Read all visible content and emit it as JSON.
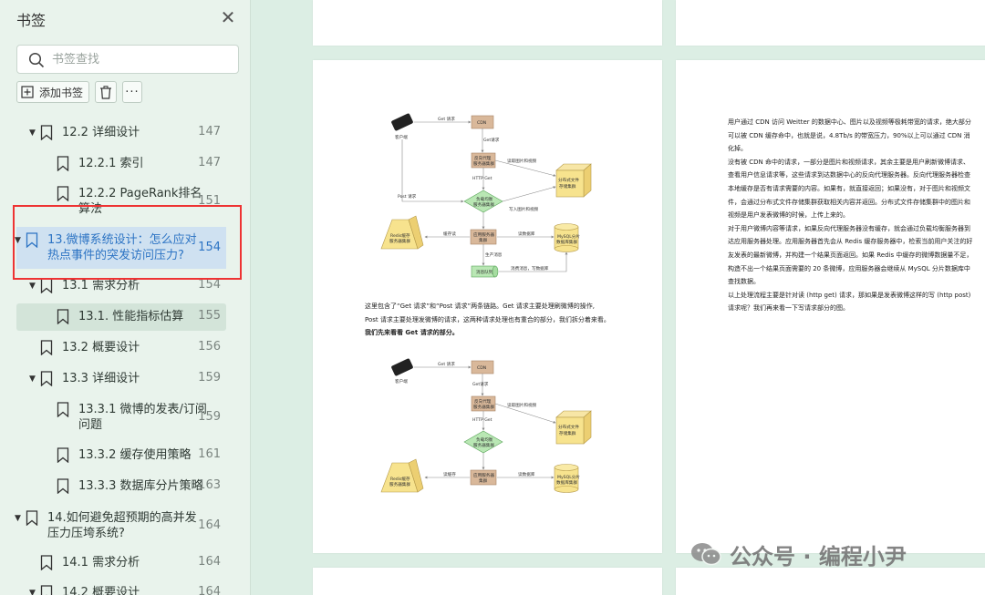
{
  "sidebar": {
    "title": "书签",
    "close_glyph": "✕",
    "search": {
      "placeholder": "书签查找",
      "value": ""
    },
    "toolbar": {
      "add_label": "添加书签",
      "more_label": "···"
    }
  },
  "bookmarks": [
    {
      "label": "12.2 详细设计",
      "page": "147",
      "expanded": true,
      "icon": "bookmark-icon"
    },
    {
      "label": "12.2.1 索引",
      "page": "147",
      "icon": "bookmark-icon"
    },
    {
      "label": "12.2.2 PageRank排名",
      "label2": "算法",
      "page": "151",
      "icon": "bookmark-icon"
    },
    {
      "label": "13.微博系统设计：怎么应对",
      "label2": "热点事件的突发访问压力?",
      "page": "154",
      "expanded": true,
      "selected": true,
      "icon": "bookmark-icon"
    },
    {
      "label": "13.1 需求分析",
      "page": "154",
      "expanded": true,
      "icon": "bookmark-icon"
    },
    {
      "label": "13.1. 性能指标估算",
      "page": "155",
      "highlighted": true,
      "icon": "bookmark-icon"
    },
    {
      "label": "13.2 概要设计",
      "page": "156",
      "icon": "bookmark-icon"
    },
    {
      "label": "13.3 详细设计",
      "page": "159",
      "expanded": true,
      "icon": "bookmark-icon"
    },
    {
      "label": "13.3.1 微博的发表/订阅",
      "label2": "问题",
      "page": "159",
      "icon": "bookmark-icon"
    },
    {
      "label": "13.3.2 缓存使用策略",
      "page": "161",
      "icon": "bookmark-icon"
    },
    {
      "label": "13.3.3 数据库分片策略",
      "page": "163",
      "icon": "bookmark-icon"
    },
    {
      "label": "14.如何避免超预期的高并发",
      "label2": "压力压垮系统?",
      "page": "164",
      "expanded": true,
      "icon": "bookmark-icon"
    },
    {
      "label": "14.1 需求分析",
      "page": "164",
      "icon": "bookmark-icon"
    },
    {
      "label": "14.2 概要设计",
      "page": "164",
      "expanded": true,
      "icon": "bookmark-icon"
    }
  ],
  "diagram": {
    "client": "客户端",
    "cdn": "CDN",
    "get_request": "Get 请求",
    "get_request2": "Get请求",
    "proxy": "反向代理",
    "proxy2": "服务器集群",
    "http_get": "HTTP Get",
    "read_images": "读取图片和视频",
    "file_storage": "分布式文件",
    "file_storage2": "存储集群",
    "post_request": "Post 请求",
    "lb": "负载均衡",
    "lb2": "服务器集群",
    "write_images": "写入图片和视频",
    "app": "应用服务器",
    "app2": "集群",
    "cache_read": "缓存读",
    "db_read": "读数据库",
    "redis": "Redis缓存",
    "redis2": "服务器集群",
    "mysql": "MySQL分片",
    "mysql2": "数据库集群",
    "produce": "生产消息",
    "mq": "消息队列",
    "consume": "消费消息，写数据库",
    "read_cache": "读缓存"
  },
  "left_text": [
    "这里包含了“Get 请求”和“Post 请求”两条链路。Get 请求主要处理刷微博的操作,",
    "Post 请求主要处理发微博的请求，这两种请求处理也有重合的部分，我们拆分着来看。",
    "我们先来看看 Get 请求的部分。"
  ],
  "right_text": [
    "用户通过 CDN 访问 Weitter 的数据中心、图片以及视频等极耗带宽的请求，绝大部分",
    "可以被 CDN 缓存命中，也就是说，4.8Tb/s 的带宽压力，90%以上可以通过 CDN 消",
    "化掉。",
    "没有被 CDN 命中的请求，一部分是图片和视频请求，其余主要是用户刷新微博请求、",
    "查看用户信息请求等，这些请求到达数据中心的反向代理服务器。反向代理服务器检查",
    "本地缓存是否有请求需要的内容。如果有，就直接返回；如果没有，对于图片和视频文",
    "件，会通过分布式文件存储集群获取相关内容并返回。分布式文件存储集群中的图片和",
    "视频是用户发表微博的时候，上传上来的。",
    "对于用户微博内容等请求，如果反向代理服务器没有缓存，就会通过负载均衡服务器到",
    "达应用服务器处理。应用服务器首先会从 Redis 缓存服务器中，检索当前用户关注的好",
    "友发表的最新微博，并构建一个结果页面返回。如果 Redis 中缓存的微博数据量不足，",
    "构造不出一个结果页面需要的 20 条微博，应用服务器会继续从 MySQL 分片数据库中",
    "查找数据。",
    "以上处理流程主要是针对读 (http get) 请求，那如果是发表微博这样的写 (http post)",
    "请求呢？我们再来看一下写请求部分的图。"
  ],
  "watermark": "公众号 · 编程小尹",
  "colors": {
    "sidebar_bg": "#e9f3ec",
    "selected_text": "#2d74c4",
    "highlight_box": "#e33333",
    "doc_bg": "#dceee4"
  }
}
